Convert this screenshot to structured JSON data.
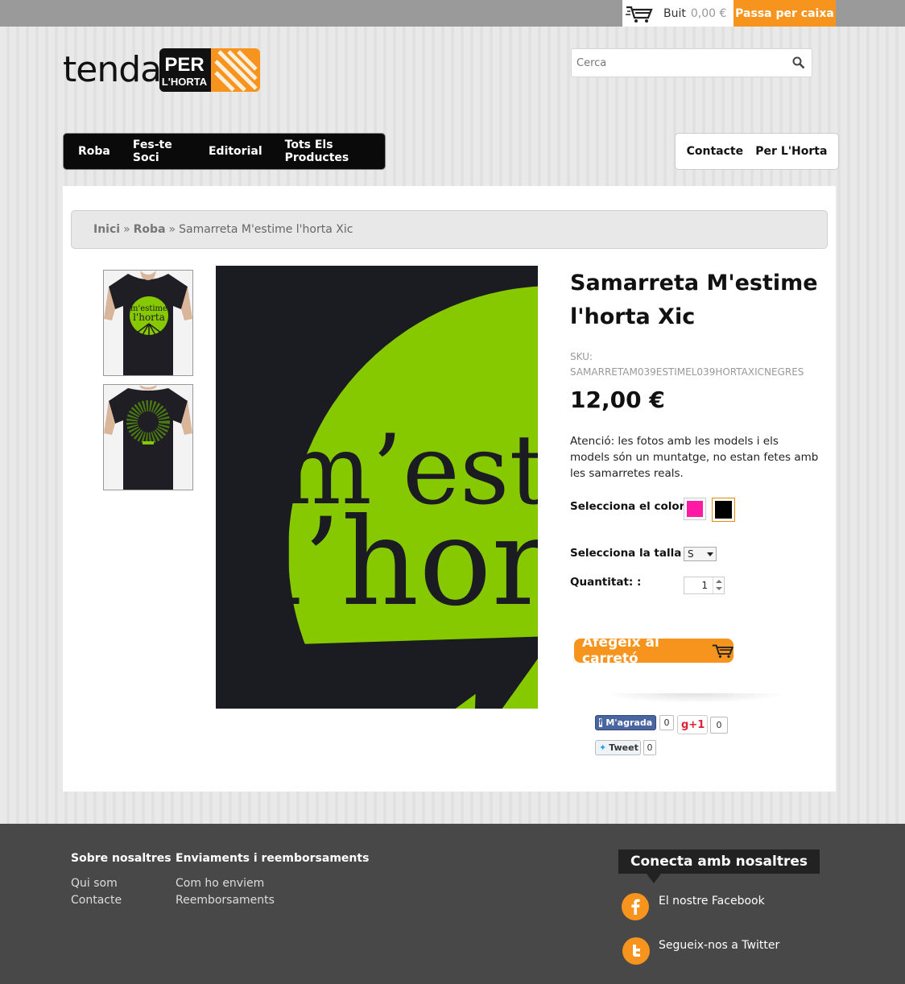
{
  "topbar": {
    "cart_label": "Buit",
    "cart_total": "0,00 €",
    "checkout_label": "Passa per caixa"
  },
  "logo": {
    "word": "tenda",
    "badge_line1": "PER",
    "badge_line2": "L'HORTA"
  },
  "search": {
    "placeholder": "Cerca"
  },
  "main_nav": [
    {
      "label": "Roba"
    },
    {
      "label": "Fes-te Soci"
    },
    {
      "label": "Editorial"
    },
    {
      "label": "Tots Els Productes"
    }
  ],
  "sub_nav": [
    {
      "label": "Contacte"
    },
    {
      "label": "Per L'Horta"
    }
  ],
  "breadcrumb": {
    "home": "Inici",
    "sep1": "»",
    "category": "Roba",
    "sep2": "»",
    "current": "Samarreta M'estime l'horta Xic"
  },
  "product": {
    "title": "Samarreta M'estime l'horta Xic",
    "sku_label": "SKU:",
    "sku_value": "SAMARRETAM039ESTIMEL039HORTAXICNEGRES",
    "price": "12,00 €",
    "note": "Atenció: les fotos amb les models i els models són un muntatge, no estan fetes amb les samarretes reals.",
    "color_label": "Selecciona el color :",
    "colors": [
      "#ff1aa6",
      "#000000"
    ],
    "size_label": "Selecciona la talla :",
    "size_value": "S",
    "qty_label": "Quantitat: :",
    "qty_value": "1",
    "add_to_cart": "Afegeix al carretó",
    "image_text_line1": "m’estim",
    "image_text_line2": "l’hor",
    "thumb_text_line1": "m'estime",
    "thumb_text_line2": "l'horta"
  },
  "social": {
    "fb_label": "M'agrada",
    "fb_count": "0",
    "gplus_label": "g+1",
    "gplus_count": "0",
    "tweet_label": "Tweet",
    "tweet_count": "0"
  },
  "footer": {
    "col1_title": "Sobre nosaltres",
    "col1_links": [
      "Qui som",
      "Contacte"
    ],
    "col2_title": "Enviaments i reemborsaments",
    "col2_links": [
      "Com ho enviem",
      "Reemborsaments"
    ],
    "connect_title": "Conecta amb nosaltres",
    "facebook_label": "El nostre Facebook",
    "twitter_label": "Segueix-nos a Twitter"
  },
  "colors": {
    "accent": "#f7941d",
    "nav_bg": "#0a0a0a",
    "footer_bg": "#484848",
    "shirt_circle": "#86c900"
  }
}
